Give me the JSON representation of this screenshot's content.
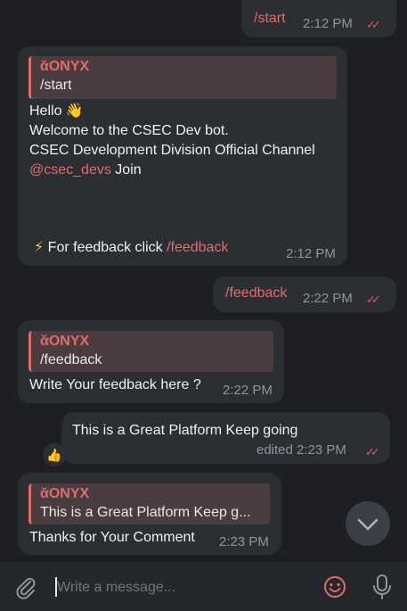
{
  "messages": {
    "m1": {
      "text": "/start",
      "time": "2:12 PM"
    },
    "m2": {
      "reply_name": "ONYX",
      "reply_text": "/start",
      "line1": "Hello 👋",
      "line2": "Welcome to the CSEC Dev bot.",
      "line3": " CSEC Development Division Official Channel",
      "handle": "@csec_devs",
      "join": " Join",
      "feedback_icon": "⚡",
      "feedback_text": " For feedback click ",
      "feedback_cmd": "/feedback",
      "time": "2:12 PM"
    },
    "m3": {
      "text": "/feedback",
      "time": "2:22 PM"
    },
    "m4": {
      "reply_name": "ONYX",
      "reply_text": "/feedback",
      "text": "Write Your feedback here ?",
      "time": "2:22 PM"
    },
    "m5": {
      "text": "This is a Great Platform Keep going",
      "edited_time": "edited 2:23 PM",
      "reaction": "👍"
    },
    "m6": {
      "reply_name": "ONYX",
      "reply_text": "This is a Great Platform Keep g...",
      "text": "Thanks for Your Comment",
      "time": "2:23 PM"
    }
  },
  "composer": {
    "placeholder": "Write a message..."
  },
  "icons": [
    "attach-icon",
    "emoji-icon",
    "mic-icon",
    "chevron-down-icon",
    "double-check-icon",
    "sender-icon"
  ],
  "colors": {
    "accent": "#e06c6c",
    "bubble": "#2b2f33",
    "background": "#1d1f22"
  }
}
